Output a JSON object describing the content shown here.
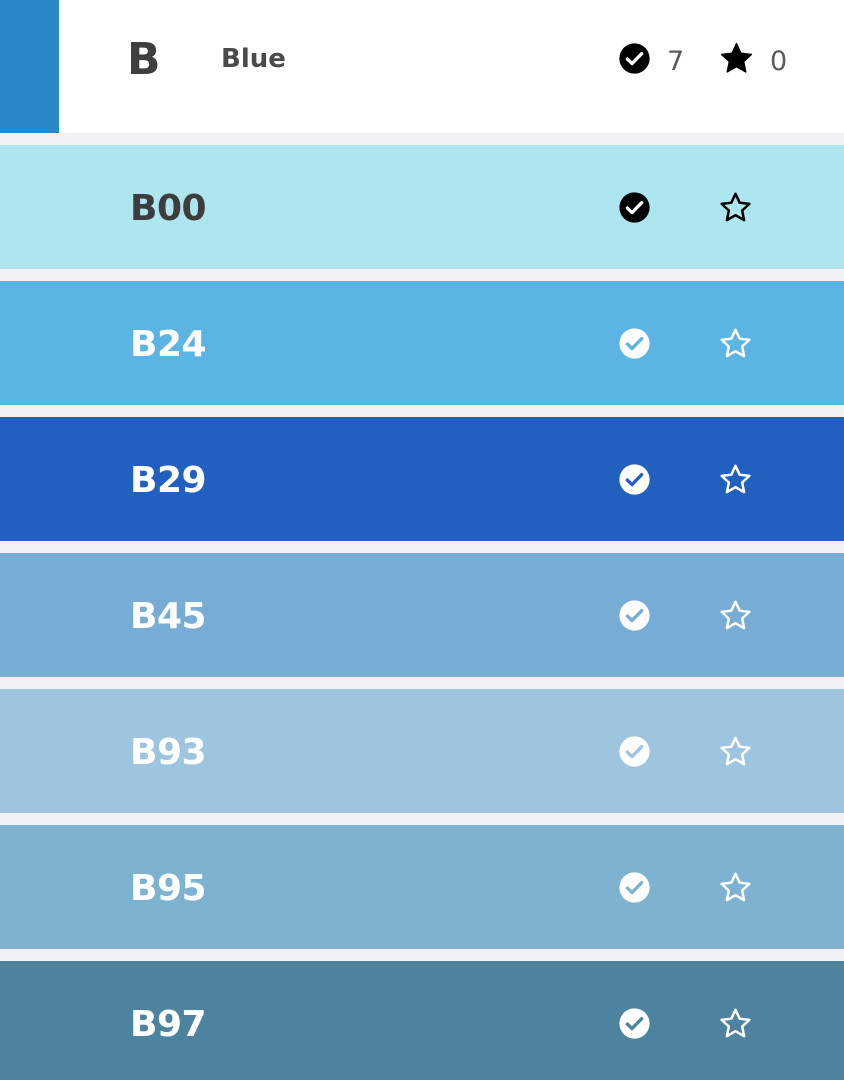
{
  "header": {
    "swatch_color": "#2b88c8",
    "letter": "B",
    "name": "Blue",
    "owned_count": "7",
    "favorite_count": "0",
    "owned_icon": "check-circle-icon",
    "favorite_icon": "star-filled-icon"
  },
  "colors": [
    {
      "code": "B00",
      "bg": "#ade6ef",
      "fg": "#3d3d3d",
      "icon": "#000000",
      "owned": true,
      "favorite": false
    },
    {
      "code": "B24",
      "bg": "#5cb4e2",
      "fg": "#ffffff",
      "icon": "#ffffff",
      "owned": true,
      "favorite": false
    },
    {
      "code": "B29",
      "bg": "#2260bf",
      "fg": "#ffffff",
      "icon": "#ffffff",
      "owned": true,
      "favorite": false
    },
    {
      "code": "B45",
      "bg": "#77acd4",
      "fg": "#ffffff",
      "icon": "#ffffff",
      "owned": true,
      "favorite": false
    },
    {
      "code": "B93",
      "bg": "#9ec5df",
      "fg": "#ffffff",
      "icon": "#ffffff",
      "owned": true,
      "favorite": false
    },
    {
      "code": "B95",
      "bg": "#7db3d1",
      "fg": "#ffffff",
      "icon": "#ffffff",
      "owned": true,
      "favorite": false
    },
    {
      "code": "B97",
      "bg": "#4e839f",
      "fg": "#ffffff",
      "icon": "#ffffff",
      "owned": true,
      "favorite": false
    }
  ]
}
